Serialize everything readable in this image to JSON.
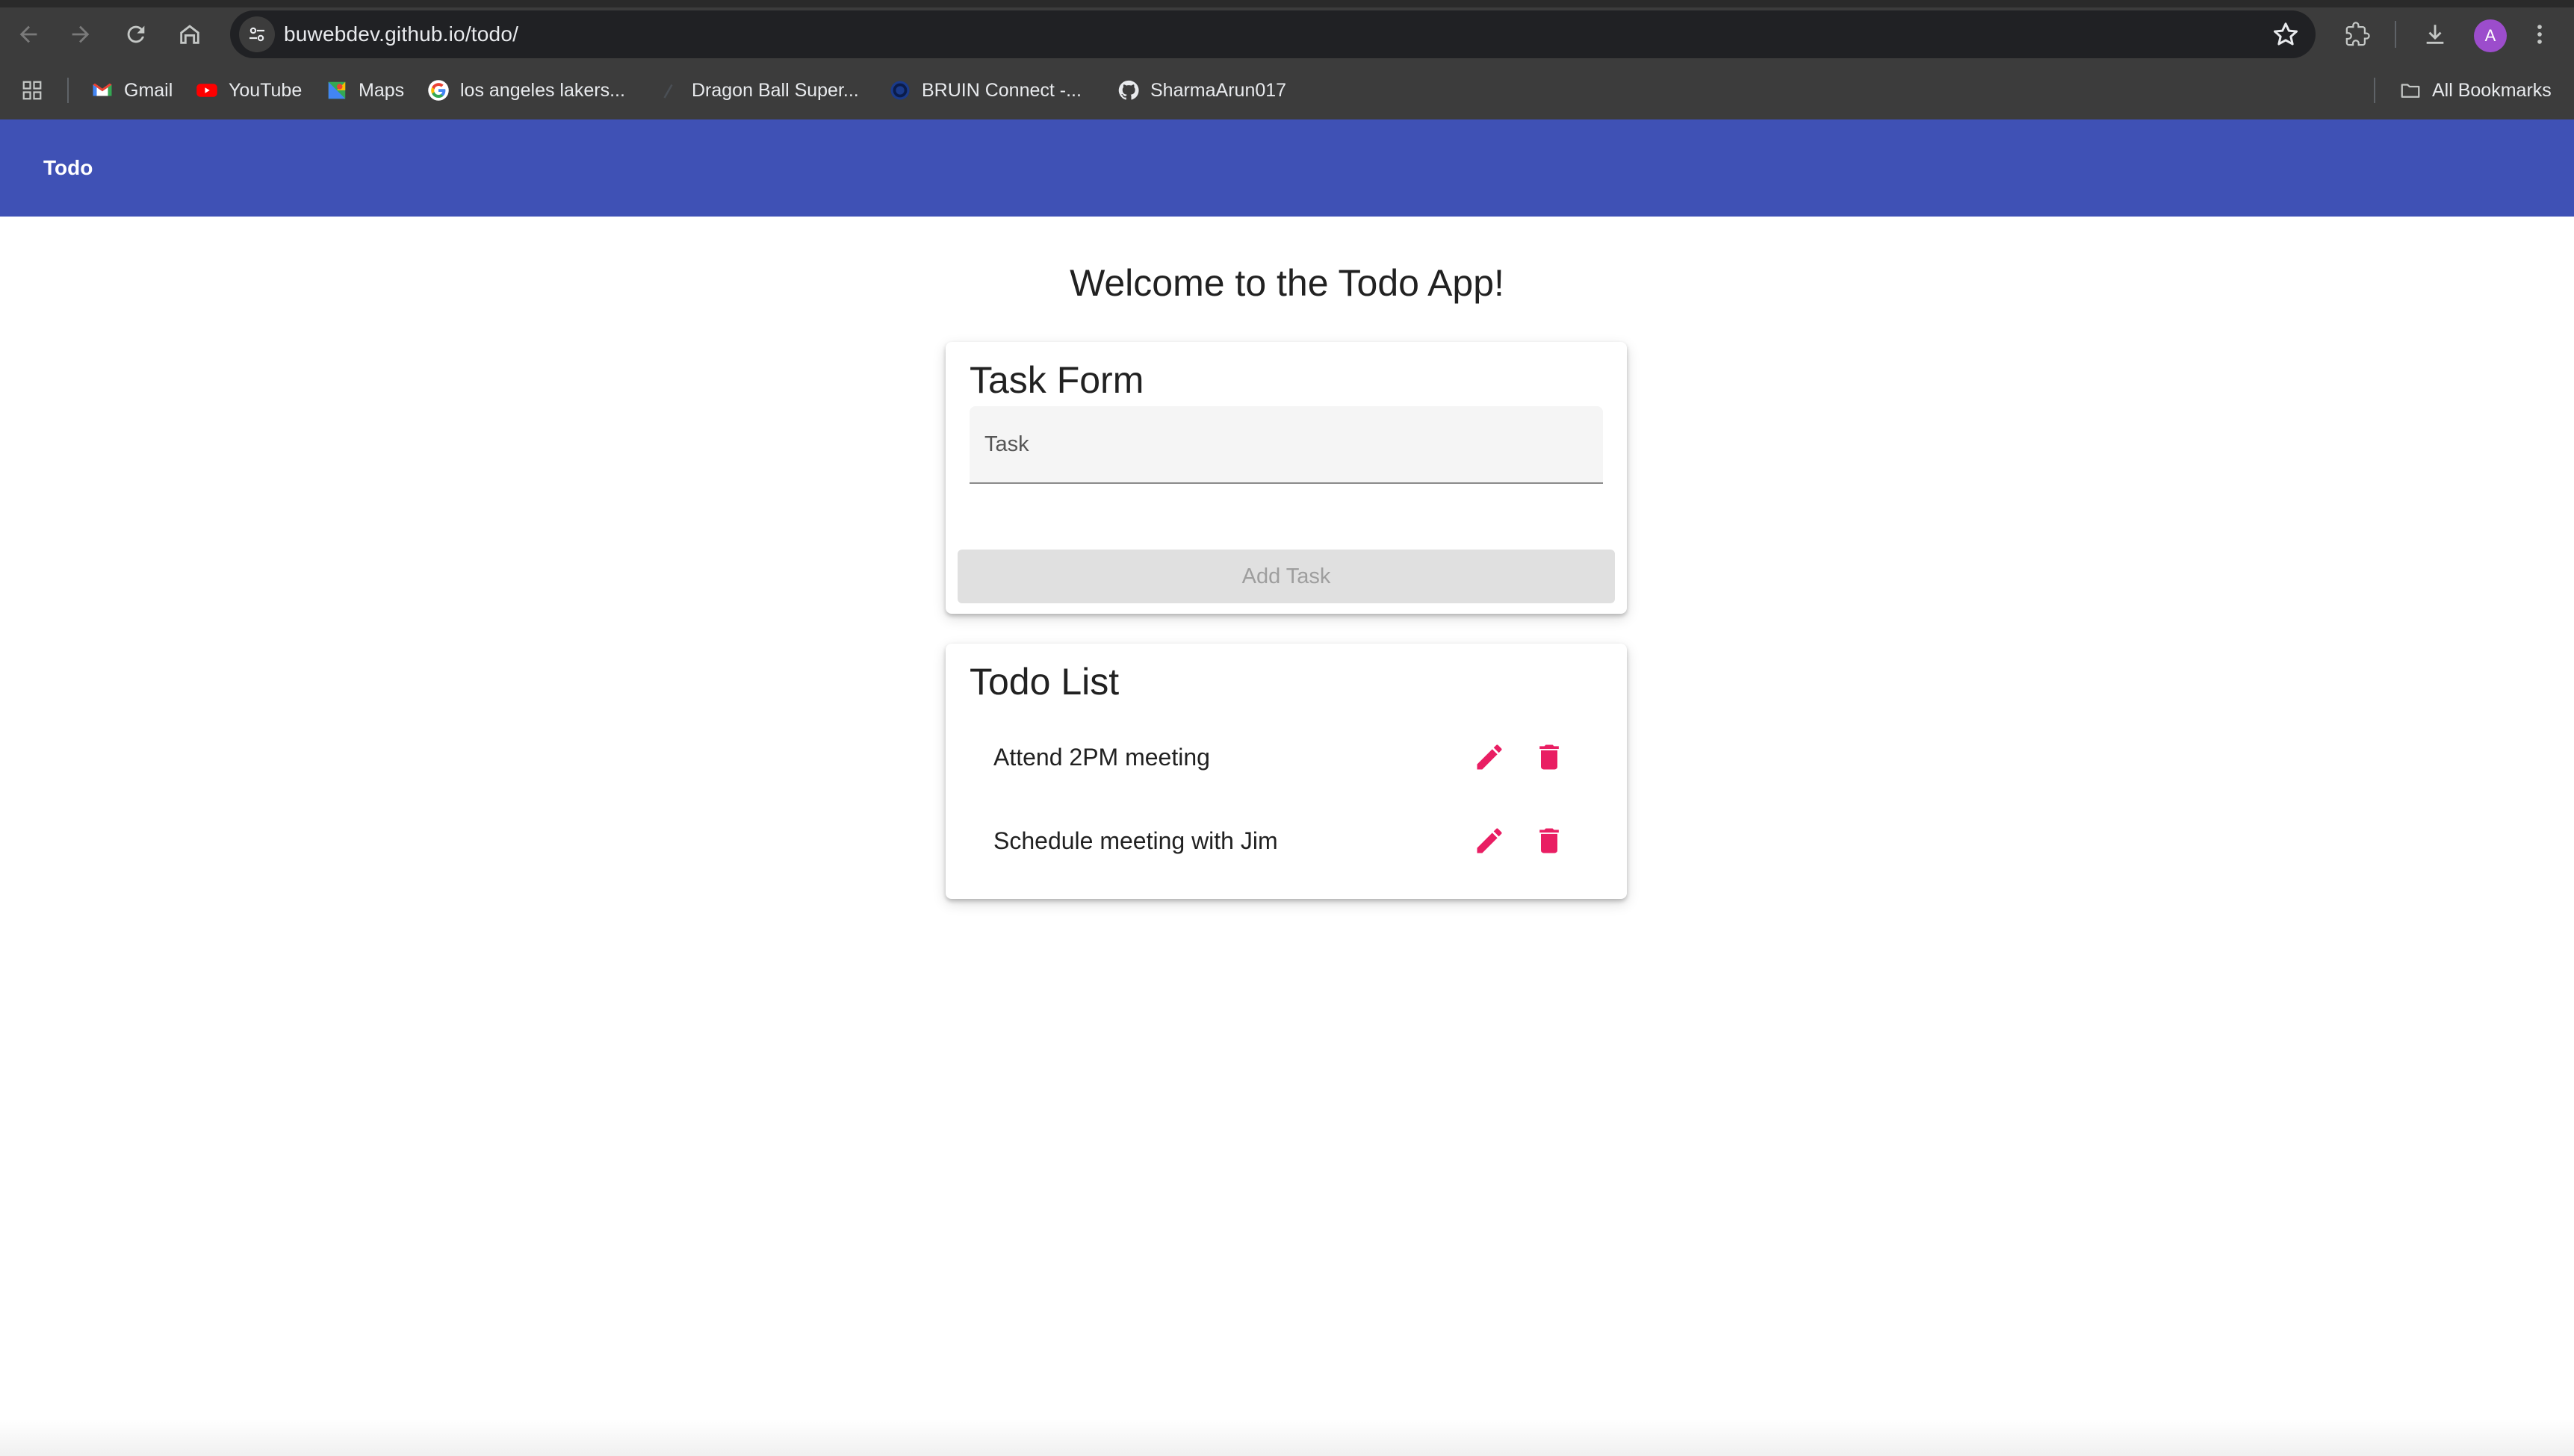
{
  "browser": {
    "url": "buwebdev.github.io/todo/",
    "avatar_letter": "A",
    "bookmarks": [
      {
        "label": "Gmail",
        "icon": "gmail-icon"
      },
      {
        "label": "YouTube",
        "icon": "youtube-icon"
      },
      {
        "label": "Maps",
        "icon": "maps-icon"
      },
      {
        "label": "los angeles lakers...",
        "icon": "google-icon"
      },
      {
        "label": "Dragon Ball Super...",
        "icon": "page-icon"
      },
      {
        "label": "BRUIN Connect -...",
        "icon": "bruin-icon"
      },
      {
        "label": "SharmaArun017",
        "icon": "github-icon"
      }
    ],
    "all_bookmarks_label": "All Bookmarks"
  },
  "app": {
    "title": "Todo",
    "welcome": "Welcome to the Todo App!",
    "form": {
      "title": "Task Form",
      "task_placeholder": "Task",
      "task_value": "",
      "add_button_label": "Add Task"
    },
    "list": {
      "title": "Todo List",
      "items": [
        {
          "text": "Attend 2PM meeting"
        },
        {
          "text": "Schedule meeting with Jim"
        }
      ]
    }
  },
  "colors": {
    "appbar": "#3f51b5",
    "accent": "#e91e63",
    "browser_chrome": "#3c3c3c"
  }
}
